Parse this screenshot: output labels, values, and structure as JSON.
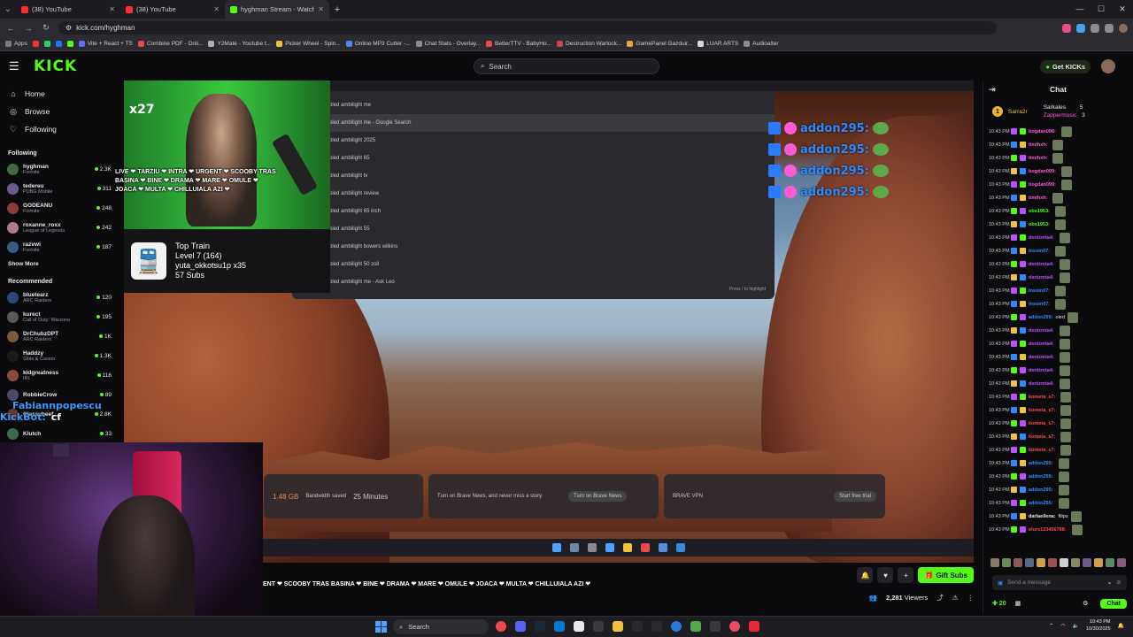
{
  "browser": {
    "tabs": [
      {
        "title": "(38) YouTube",
        "icon": "youtube-icon"
      },
      {
        "title": "(38) YouTube",
        "icon": "youtube-icon"
      },
      {
        "title": "hyghman Stream - Watch Live",
        "icon": "kick-icon"
      }
    ],
    "url": "kick.com/hyghman",
    "bookmarks": [
      "Apps",
      "Vite + React + TS",
      "Combine PDF - Onli...",
      "Y2Mate - Youtube t...",
      "Picker Wheel - Spin...",
      "Online MP3 Cutter -...",
      "Chat Stats - Overlay...",
      "BetterTTV - BabyHo...",
      "Destruction Warlock...",
      "GamePanel Gazduir...",
      "LUAR ARTS",
      "Audioalter"
    ]
  },
  "header": {
    "logo": "KICK",
    "search_placeholder": "Search",
    "get_kicks": "Get KICKs"
  },
  "sidebar": {
    "nav": [
      {
        "label": "Home",
        "icon": "home-icon"
      },
      {
        "label": "Browse",
        "icon": "browse-icon"
      },
      {
        "label": "Following",
        "icon": "heart-icon"
      }
    ],
    "following_title": "Following",
    "following": [
      {
        "name": "hyghman",
        "category": "Fortnite",
        "viewers": "2.3K",
        "color": "#3f6b3a"
      },
      {
        "name": "tedereu",
        "category": "PUBG Mobile",
        "viewers": "311",
        "color": "#6b5b8a"
      },
      {
        "name": "GODEANU",
        "category": "Fortnite",
        "viewers": "248",
        "color": "#8a3a3a"
      },
      {
        "name": "roxanne_roxx",
        "category": "League of Legends",
        "viewers": "242",
        "color": "#b07a8a"
      },
      {
        "name": "razvwi",
        "category": "Fortnite",
        "viewers": "187",
        "color": "#3a5a8a"
      }
    ],
    "show_more": "Show More",
    "recommended_title": "Recommended",
    "recommended": [
      {
        "name": "bluetearz",
        "category": "ARC Raiders",
        "viewers": "120",
        "color": "#2a4a7a"
      },
      {
        "name": "kurect",
        "category": "Call of Duty: Warzone",
        "viewers": "195",
        "color": "#5a5a5a"
      },
      {
        "name": "DrChubzDPT",
        "category": "ARC Raiders",
        "viewers": "1K",
        "color": "#7a5a3a"
      },
      {
        "name": "Haddzy",
        "category": "Slots & Casino",
        "viewers": "1.3K",
        "color": "#1a1a1a"
      },
      {
        "name": "kidgreatness",
        "category": "IRL",
        "viewers": "116",
        "color": "#8a4a3a"
      },
      {
        "name": "RobbieCrow",
        "category": "",
        "viewers": "89",
        "color": "#4a4a6a"
      },
      {
        "name": "Classybeef",
        "category": "",
        "viewers": "2.8K",
        "color": "#6a3a2a"
      },
      {
        "name": "Klutch",
        "category": "",
        "viewers": "33",
        "color": "#3a6a4a"
      }
    ]
  },
  "stream": {
    "search_suggestions": [
      "philips oled ambilight me",
      "philips oled ambilight me - Google Search",
      "philips oled ambilight 2025",
      "philips oled ambilight 65",
      "philips oled ambilight tv",
      "philips oled ambilight review",
      "philips oled ambilight 65 inch",
      "philips oled ambilight 55",
      "philips oled ambilight bowers wilkins",
      "philips oled ambilight 50 zoll",
      "philips oled ambilight me - Ask Leo"
    ],
    "omnibox_hint": "Press / to highlight",
    "brave": {
      "bandwidth": "1.48 GB",
      "bandwidth_label": "Bandwidth saved",
      "time": "25 Minutes",
      "news_title": "Turn on Brave News, and never miss a story",
      "news_button": "Turn on Brave News",
      "vpn": "BRAVE VPN",
      "vpn_button": "Start free trial"
    },
    "chat_overlay": [
      "addon295:",
      "addon295:",
      "addon295:",
      "addon295:"
    ],
    "cam_label": "x27",
    "ticker": "LIVE ❤ TARZIU ❤ INTRA ❤ URGENT ❤ SCOOBY TRAS BASINA ❤ BINE ❤ DRAMA ❤ MARE ❤ OMULE ❤ JOACA ❤ MULTA ❤ CHILLUIALA AZI ❤",
    "top_train": {
      "title": "Top Train",
      "level": "Level 7 (164)",
      "user": "yuta_okkotsu1p x35",
      "subs": "57 Subs"
    },
    "overlay_users": {
      "line1": "Fabiannpopescu",
      "line2": "KickBot:",
      "text": "cf"
    }
  },
  "player": {
    "marquee": "ENT ❤ SCOOBY TRAS BASINA ❤ BINE ❤ DRAMA ❤ MARE ❤ OMULE ❤ JOACA ❤ MULTA ❤ CHILLUIALA AZI ❤",
    "gift_subs": "Gift Subs",
    "viewers": "2,281",
    "viewers_label": "Viewers"
  },
  "chat": {
    "title": "Chat",
    "pinned": {
      "rank": "1",
      "user1": "Sarra2r",
      "user2": "Sarkales",
      "count1": "5",
      "user3": "Zappermusic",
      "count2": "3"
    },
    "messages": [
      {
        "time": "10:43 PM",
        "user": "bogdan098:",
        "color": "#ff5ad6",
        "text": ""
      },
      {
        "time": "10:43 PM",
        "user": "timihxh:",
        "color": "#ff5ad6",
        "text": ""
      },
      {
        "time": "10:43 PM",
        "user": "timihxh:",
        "color": "#ff5ad6",
        "text": ""
      },
      {
        "time": "10:43 PM",
        "user": "bogdan099:",
        "color": "#ff5ad6",
        "text": ""
      },
      {
        "time": "10:43 PM",
        "user": "bogdan099:",
        "color": "#ff5ad6",
        "text": ""
      },
      {
        "time": "10:43 PM",
        "user": "timihxh:",
        "color": "#ff5ad6",
        "text": ""
      },
      {
        "time": "10:43 PM",
        "user": "obs1953:",
        "color": "#53fc18",
        "text": ""
      },
      {
        "time": "10:43 PM",
        "user": "obs1953:",
        "color": "#53fc18",
        "text": ""
      },
      {
        "time": "10:43 PM",
        "user": "denizmta4:",
        "color": "#c050ff",
        "text": ""
      },
      {
        "time": "10:43 PM",
        "user": "lnsoin07:",
        "color": "#2e8bff",
        "text": ""
      },
      {
        "time": "10:43 PM",
        "user": "denizmta4:",
        "color": "#c050ff",
        "text": ""
      },
      {
        "time": "10:43 PM",
        "user": "denizmta4:",
        "color": "#c050ff",
        "text": ""
      },
      {
        "time": "10:43 PM",
        "user": "lnsoin07:",
        "color": "#2e8bff",
        "text": ""
      },
      {
        "time": "10:43 PM",
        "user": "lnsoin07:",
        "color": "#2e8bff",
        "text": ""
      },
      {
        "time": "10:43 PM",
        "user": "addon295:",
        "color": "#2e8bff",
        "text": "oled"
      },
      {
        "time": "10:43 PM",
        "user": "denizmta4:",
        "color": "#c050ff",
        "text": ""
      },
      {
        "time": "10:43 PM",
        "user": "denizmta4:",
        "color": "#c050ff",
        "text": ""
      },
      {
        "time": "10:43 PM",
        "user": "denizmta4:",
        "color": "#c050ff",
        "text": ""
      },
      {
        "time": "10:43 PM",
        "user": "denizmta4:",
        "color": "#c050ff",
        "text": ""
      },
      {
        "time": "10:43 PM",
        "user": "denizmta4:",
        "color": "#c050ff",
        "text": ""
      },
      {
        "time": "10:43 PM",
        "user": "kometa_s7:",
        "color": "#ff4a4a",
        "text": ""
      },
      {
        "time": "10:43 PM",
        "user": "kometa_s7:",
        "color": "#ff4a4a",
        "text": ""
      },
      {
        "time": "10:43 PM",
        "user": "kometa_s7:",
        "color": "#ff4a4a",
        "text": ""
      },
      {
        "time": "10:43 PM",
        "user": "kometa_s7:",
        "color": "#ff4a4a",
        "text": ""
      },
      {
        "time": "10:43 PM",
        "user": "kometa_s7:",
        "color": "#ff4a4a",
        "text": ""
      },
      {
        "time": "10:43 PM",
        "user": "addon295:",
        "color": "#2e8bff",
        "text": ""
      },
      {
        "time": "10:43 PM",
        "user": "addon295:",
        "color": "#2e8bff",
        "text": ""
      },
      {
        "time": "10:43 PM",
        "user": "addon295:",
        "color": "#2e8bff",
        "text": ""
      },
      {
        "time": "10:43 PM",
        "user": "addon295:",
        "color": "#2e8bff",
        "text": ""
      },
      {
        "time": "10:43 PM",
        "user": "darlaellena:",
        "color": "#e8e8ea",
        "text": "filips"
      },
      {
        "time": "10:43 PM",
        "user": "elurs123456788:",
        "color": "#ff4a4a",
        "text": ""
      }
    ],
    "input_placeholder": "Send a message",
    "points": "20",
    "chat_button": "Chat"
  },
  "taskbar": {
    "search": "Search",
    "time": "10:43 PM",
    "date": "10/30/2025"
  }
}
